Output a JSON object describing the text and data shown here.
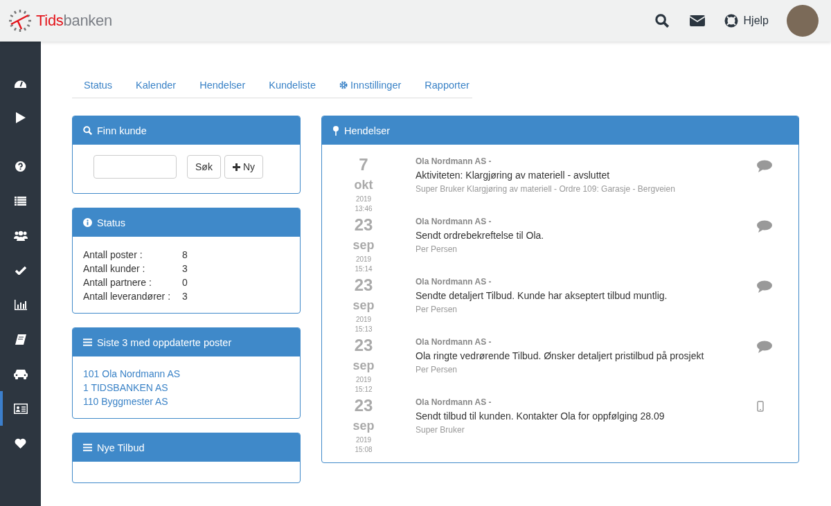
{
  "logo": {
    "first": "Tids",
    "second": "banken"
  },
  "topbar": {
    "help": "Hjelp"
  },
  "sidebar": {
    "items": [
      {
        "kind": "dashboard",
        "selected": false
      },
      {
        "kind": "play",
        "selected": false
      },
      {
        "kind": "help",
        "selected": false
      },
      {
        "kind": "list",
        "selected": false
      },
      {
        "kind": "users",
        "selected": false
      },
      {
        "kind": "check",
        "selected": false
      },
      {
        "kind": "chart",
        "selected": false
      },
      {
        "kind": "book",
        "selected": false
      },
      {
        "kind": "car",
        "selected": false
      },
      {
        "kind": "card",
        "selected": true
      },
      {
        "kind": "heart",
        "selected": false
      }
    ]
  },
  "tabs": [
    {
      "label": "Status",
      "kind": "plain"
    },
    {
      "label": "Kalender",
      "kind": "plain"
    },
    {
      "label": "Hendelser",
      "kind": "plain"
    },
    {
      "label": "Kundeliste",
      "kind": "plain"
    },
    {
      "label": "Innstillinger",
      "kind": "settings"
    },
    {
      "label": "Rapporter",
      "kind": "plain"
    }
  ],
  "find_customer": {
    "title": "Finn kunde",
    "search_button": "Søk",
    "new_button": "Ny"
  },
  "status": {
    "title": "Status",
    "rows": [
      {
        "label": "Antall poster :",
        "value": "8"
      },
      {
        "label": "Antall kunder :",
        "value": "3"
      },
      {
        "label": "Antall partnere :",
        "value": "0"
      },
      {
        "label": "Antall leverandører :",
        "value": "3"
      }
    ]
  },
  "recent": {
    "title": "Siste 3 med oppdaterte poster",
    "links": [
      "101 Ola Nordmann AS",
      "1 TIDSBANKEN AS",
      "110 Byggmester AS"
    ]
  },
  "offers": {
    "title": "Nye Tilbud"
  },
  "events": {
    "title": "Hendelser",
    "items": [
      {
        "day": "7",
        "month": "okt",
        "year": "2019",
        "time": "13:46",
        "customer": "Ola Nordmann AS -",
        "text": "Aktiviteten: Klargjøring av materiell - avsluttet",
        "detail": "Super Bruker Klargjøring av materiell - Ordre 109: Garasje - Bergveien",
        "kind": "comment"
      },
      {
        "day": "23",
        "month": "sep",
        "year": "2019",
        "time": "15:14",
        "customer": "Ola Nordmann AS -",
        "text": "Sendt ordrebekreftelse til Ola.",
        "detail": "Per Persen",
        "kind": "comment"
      },
      {
        "day": "23",
        "month": "sep",
        "year": "2019",
        "time": "15:13",
        "customer": "Ola Nordmann AS -",
        "text": "Sendte detaljert Tilbud. Kunde har akseptert tilbud muntlig.",
        "detail": "Per Persen",
        "kind": "comment"
      },
      {
        "day": "23",
        "month": "sep",
        "year": "2019",
        "time": "15:12",
        "customer": "Ola Nordmann AS -",
        "text": "Ola ringte vedrørende Tilbud. Ønsker detaljert pristilbud på prosjekt",
        "detail": "Per Persen",
        "kind": "comment"
      },
      {
        "day": "23",
        "month": "sep",
        "year": "2019",
        "time": "15:08",
        "customer": "Ola Nordmann AS -",
        "text": "Sendt tilbud til kunden. Kontakter Ola for oppfølging 28.09",
        "detail": "Super Bruker",
        "kind": "phone"
      }
    ]
  }
}
